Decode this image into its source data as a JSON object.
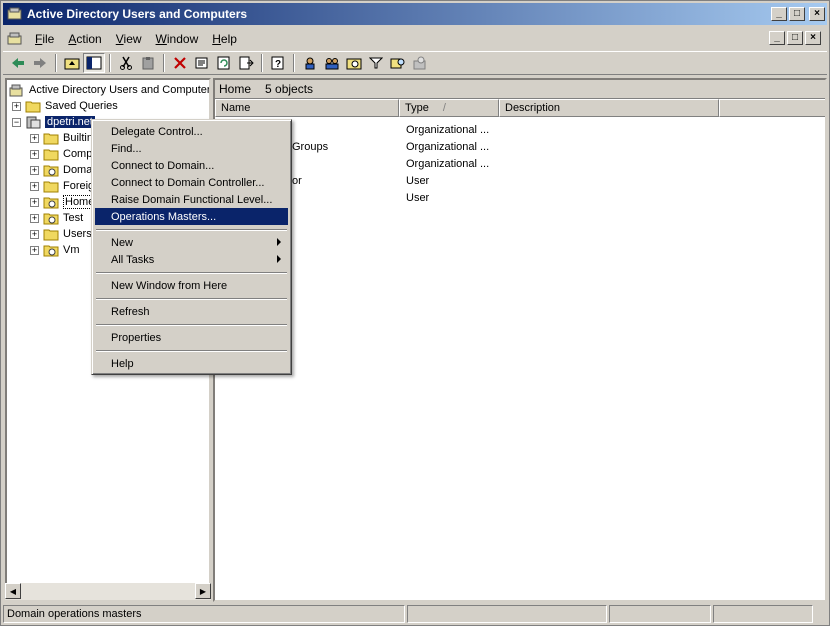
{
  "window": {
    "title": "Active Directory Users and Computers"
  },
  "titlebar_buttons": [
    "_",
    "□",
    "×"
  ],
  "menubar": {
    "items": [
      {
        "first": "F",
        "rest": "ile"
      },
      {
        "first": "A",
        "rest": "ction"
      },
      {
        "first": "V",
        "rest": "iew"
      },
      {
        "first": "W",
        "rest": "indow"
      },
      {
        "first": "H",
        "rest": "elp"
      }
    ]
  },
  "tree": {
    "root_label": "Active Directory Users and Computers",
    "saved_queries": "Saved Queries",
    "domain": "dpetri.net",
    "children": [
      "Builtin",
      "Computers",
      "Domain Controllers",
      "ForeignSecurityPrincipals",
      "Home",
      "Test",
      "Users",
      "Vm"
    ]
  },
  "right_pane": {
    "location": "Home",
    "count": "5 objects",
    "columns": {
      "name": "Name",
      "type": "Type",
      "sort_mark": "/",
      "description": "Description"
    },
    "rows": [
      {
        "name": "",
        "type": "Organizational ..."
      },
      {
        "name": "Groups",
        "type": "Organizational ..."
      },
      {
        "name": "",
        "type": "Organizational ..."
      },
      {
        "name": "or",
        "type": "User"
      },
      {
        "name": "",
        "type": "User"
      }
    ]
  },
  "context_menu": {
    "items": [
      "Delegate Control...",
      "Find...",
      "Connect to Domain...",
      "Connect to Domain Controller...",
      "Raise Domain Functional Level...",
      "Operations Masters...",
      "New",
      "All Tasks",
      "New Window from Here",
      "Refresh",
      "Properties",
      "Help"
    ],
    "highlighted": "Operations Masters..."
  },
  "statusbar": {
    "text": "Domain operations masters"
  },
  "colors": {
    "title_start": "#0a246a",
    "title_end": "#a6caf0",
    "highlight": "#0a246a",
    "chrome": "#d4d0c8"
  }
}
